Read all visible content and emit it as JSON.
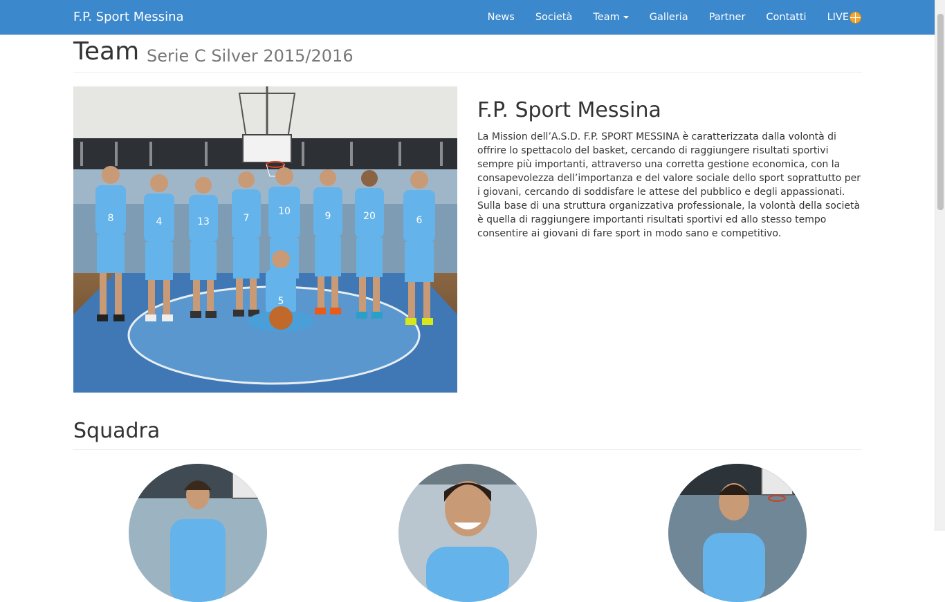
{
  "navbar": {
    "brand": "F.P. Sport Messina",
    "items": [
      {
        "label": "News"
      },
      {
        "label": "Società"
      },
      {
        "label": "Team"
      },
      {
        "label": "Galleria"
      },
      {
        "label": "Partner"
      },
      {
        "label": "Contatti"
      },
      {
        "label": "LIVE"
      }
    ],
    "live_icon": "basketball-icon",
    "color": "#3c88cc"
  },
  "header": {
    "title": "Team",
    "subtitle": "Serie C Silver 2015/2016"
  },
  "intro": {
    "title": "F.P. Sport Messina",
    "text": "La Mission dell’A.S.D. F.P. SPORT MESSINA è caratterizzata dalla volontà di offrire lo spettacolo del basket, cercando di raggiungere risultati sportivi sempre più importanti, attraverso una corretta gestione economica, con la consapevolezza dell’importanza e del valore sociale dello sport soprattutto per i giovani, cercando di soddisfare le attese del pubblico e degli appassionati. Sulla base di una struttura organizzativa professionale, la volontà della società è quella di raggiungere importanti risultati sportivi ed allo stesso tempo consentire ai giovani di fare sport in modo sano e competitivo."
  },
  "team_photo": {
    "jersey_numbers": [
      "8",
      "4",
      "13",
      "7",
      "10",
      "9",
      "20",
      "6",
      "5"
    ]
  },
  "squad": {
    "title": "Squadra"
  }
}
